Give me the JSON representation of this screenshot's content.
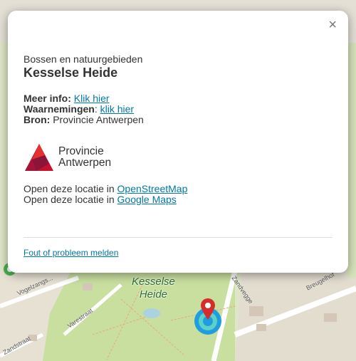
{
  "popup": {
    "close_symbol": "×",
    "category": "Bossen en natuurgebieden",
    "title": "Kesselse Heide",
    "info": {
      "meer_info_label": "Meer info:",
      "meer_info_link": "Klik hier",
      "waarnemingen_label": "Waarnemingen",
      "waarnemingen_sep": ":",
      "waarnemingen_link": "klik hier",
      "bron_label": "Bron:",
      "bron_value": "Provincie Antwerpen"
    },
    "logo": {
      "line1": "Provincie",
      "line2": "Antwerpen"
    },
    "open_links": {
      "prefix": "Open deze locatie in",
      "osm": "OpenStreetMap",
      "google": "Google Maps"
    },
    "report_link": "Fout of probleem melden"
  },
  "map": {
    "place_label_line1": "Kesselse",
    "place_label_line2": "Heide",
    "streets": [
      "Vogelzangs...",
      "Varestraat",
      "Zandvegge",
      "Breugelhof",
      "Zandstraat"
    ]
  },
  "colors": {
    "link": "#0078a8",
    "logo_red": "#c8102e",
    "logo_dark": "#8a1538",
    "marker_red": "#d62c2c",
    "location_blue": "#1e9de0"
  },
  "icons": {
    "close": "close-icon",
    "logo": "provincie-antwerpen-logo",
    "marker": "map-pin-icon",
    "location": "current-location-icon"
  }
}
